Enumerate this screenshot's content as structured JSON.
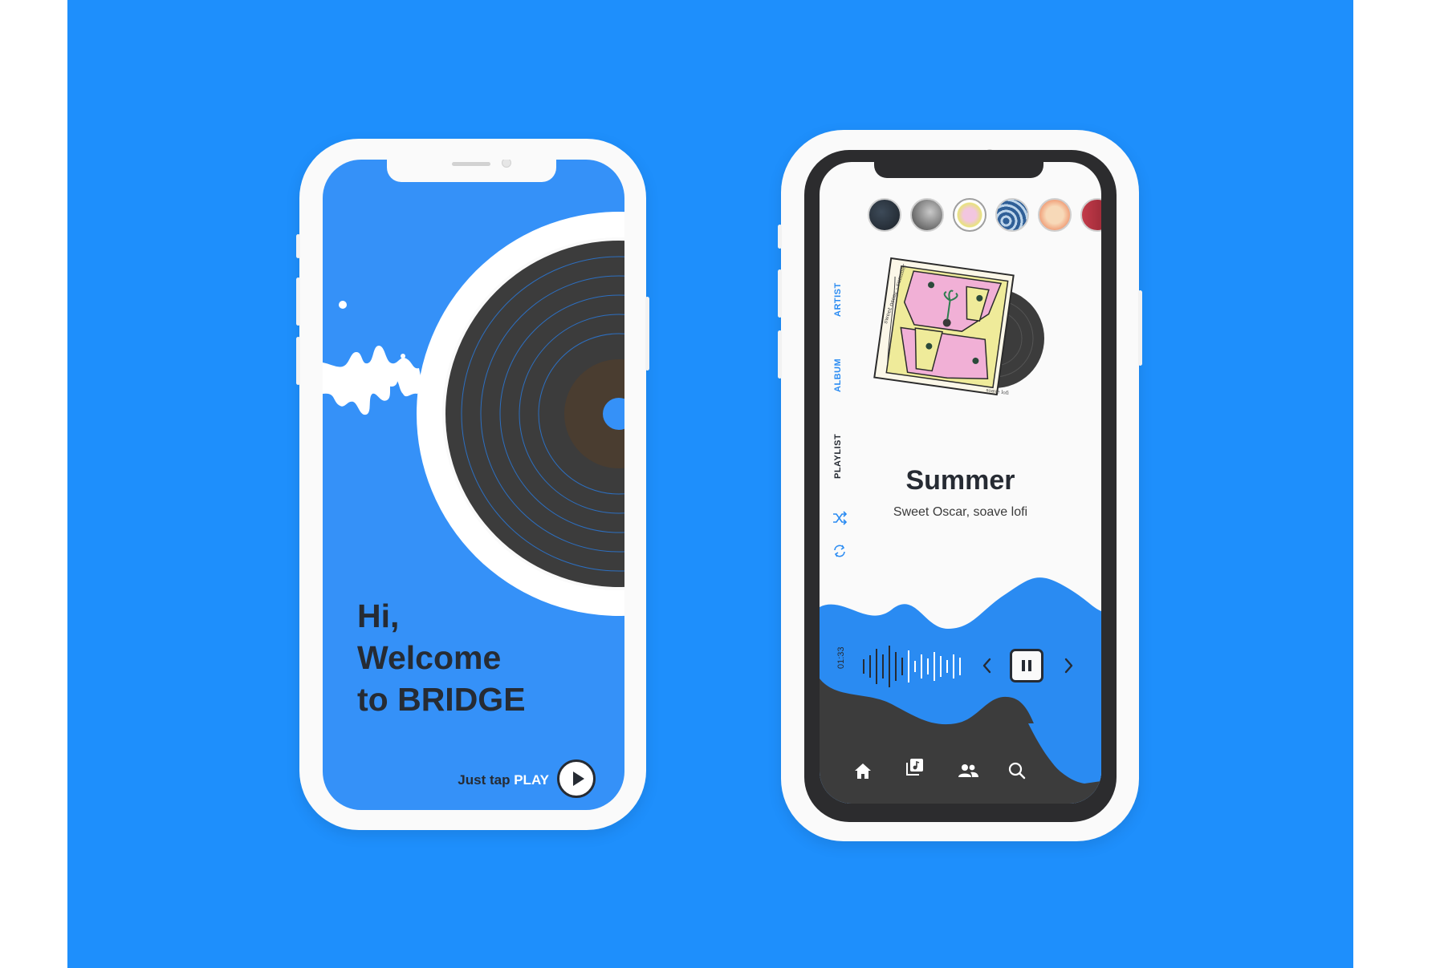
{
  "colors": {
    "background": "#1e8ffc",
    "screen_blue": "#3591f8",
    "dark": "#262b33",
    "vinyl": "#3c3c3c",
    "accent": "#2a8bf2"
  },
  "welcome_screen": {
    "greeting_line1": "Hi,",
    "greeting_line2": "Welcome",
    "greeting_line3": "to BRIDGE",
    "cta_prefix": "Just tap",
    "cta_action": "PLAY",
    "play_icon": "play-icon"
  },
  "player_screen": {
    "side_tabs": {
      "artist": "ARTIST",
      "album": "ALBUM",
      "playlist": "PLAYLIST"
    },
    "side_icons": [
      "shuffle-icon",
      "repeat-icon"
    ],
    "now_playing": {
      "title": "Summer",
      "subtitle": "Sweet Oscar, soave lofi",
      "elapsed": "01:33"
    },
    "cover_art": {
      "handwritten_text": "sweet oscar - summer",
      "signature": "soave lofi"
    },
    "controls": [
      "previous-icon",
      "pause-icon",
      "next-icon"
    ],
    "bottom_nav": [
      "home-icon",
      "library-icon",
      "people-icon",
      "search-icon"
    ]
  }
}
